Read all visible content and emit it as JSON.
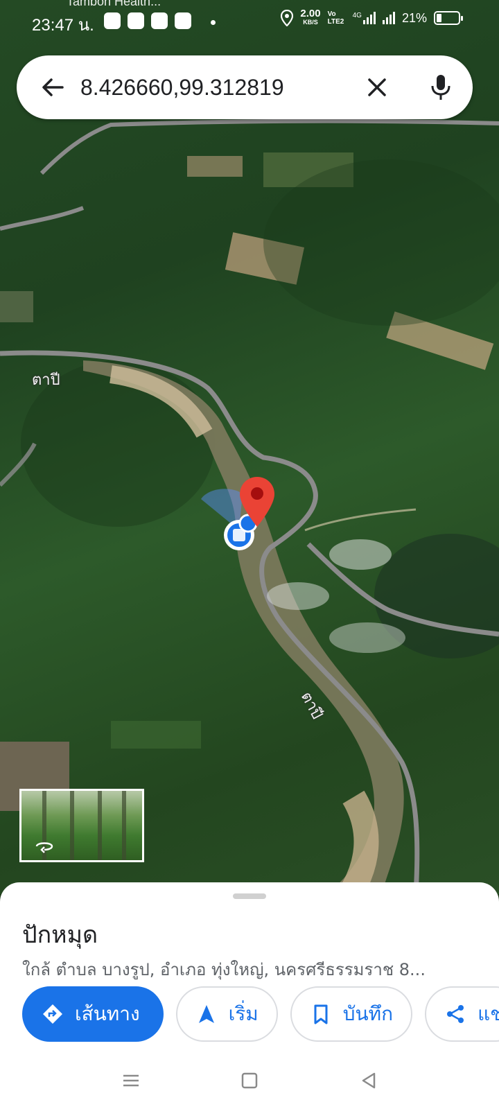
{
  "status_bar": {
    "notification_peek": "Tambon Health...",
    "time": "23:47 น.",
    "net_speed_value": "2.00",
    "net_speed_unit": "KB/S",
    "volte": "Vo LTE2",
    "network": "4G",
    "battery": "21%",
    "battery_level": 0.21
  },
  "search": {
    "query": "8.426660,99.312819"
  },
  "map": {
    "road_labels": [
      "ตาปี",
      "ตาปี"
    ],
    "pin_color": "#ea4335"
  },
  "place": {
    "title": "ปักหมุด",
    "subtitle": "ใกล้ ตำบล บางรูป, อำเภอ ทุ่งใหญ่, นครศรีธรรมราช 8..."
  },
  "actions": {
    "directions_label": "เส้นทาง",
    "start_label": "เริ่ม",
    "save_label": "บันทึก",
    "share_label": "แช"
  },
  "colors": {
    "accent": "#1a73e8",
    "text_primary": "#202124",
    "text_secondary": "#5f6368"
  }
}
